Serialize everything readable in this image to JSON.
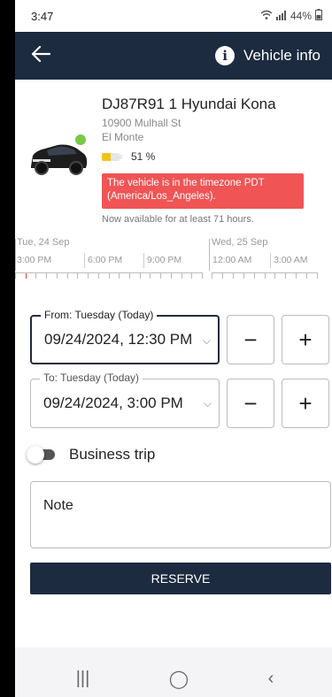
{
  "status_bar": {
    "time": "3:47",
    "battery_percent": "44%"
  },
  "app_bar": {
    "vehicle_info_label": "Vehicle info"
  },
  "vehicle": {
    "title": "DJ87R91 1 Hyundai Kona",
    "address_line1": "10900 Mulhall St",
    "address_line2": "El Monte",
    "battery_label": "51 %",
    "battery_level": 0.51,
    "timezone_alert": "The vehicle is in the timezone PDT (America/Los_Angeles).",
    "availability": "Now available for at least 71 hours."
  },
  "timeline": {
    "days": [
      "Tue, 24 Sep",
      "Wed, 25 Sep"
    ],
    "times": [
      "3:00 PM",
      "6:00 PM",
      "9:00 PM",
      "12:00 AM",
      "3:00 AM"
    ]
  },
  "from": {
    "legend": "From: Tuesday (Today)",
    "value": "09/24/2024, 12:30 PM",
    "minus": "−",
    "plus": "+"
  },
  "to": {
    "legend": "To: Tuesday (Today)",
    "value": "09/24/2024, 3:00 PM",
    "minus": "−",
    "plus": "+"
  },
  "business_trip": {
    "label": "Business trip",
    "enabled": false
  },
  "note": {
    "placeholder": "Note"
  },
  "reserve": {
    "label": "RESERVE"
  },
  "nav": {
    "recents": "|||",
    "home": "◯",
    "back": "‹"
  },
  "colors": {
    "header": "#1c2b3f",
    "alert": "#f05454",
    "battery": "#f2c21b",
    "online_dot": "#7ac943"
  }
}
